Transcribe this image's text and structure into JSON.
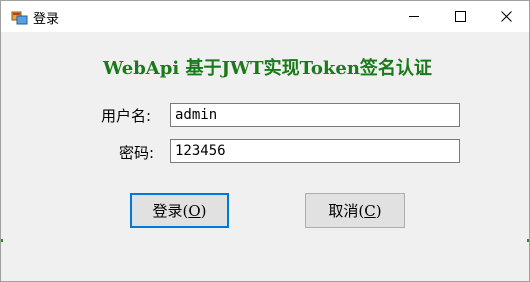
{
  "window": {
    "title": "登录"
  },
  "form": {
    "heading": "WebApi 基于JWT实现Token签名认证",
    "username_label": "用户名:",
    "username_value": "admin",
    "password_label": "密码:",
    "password_value": "123456"
  },
  "buttons": {
    "login": {
      "text": "登录(",
      "accel": "O",
      "close": ")"
    },
    "cancel": {
      "text": "取消(",
      "accel": "C",
      "close": ")"
    }
  },
  "colors": {
    "heading": "#1a7a1a",
    "focus_border": "#0078d7"
  }
}
